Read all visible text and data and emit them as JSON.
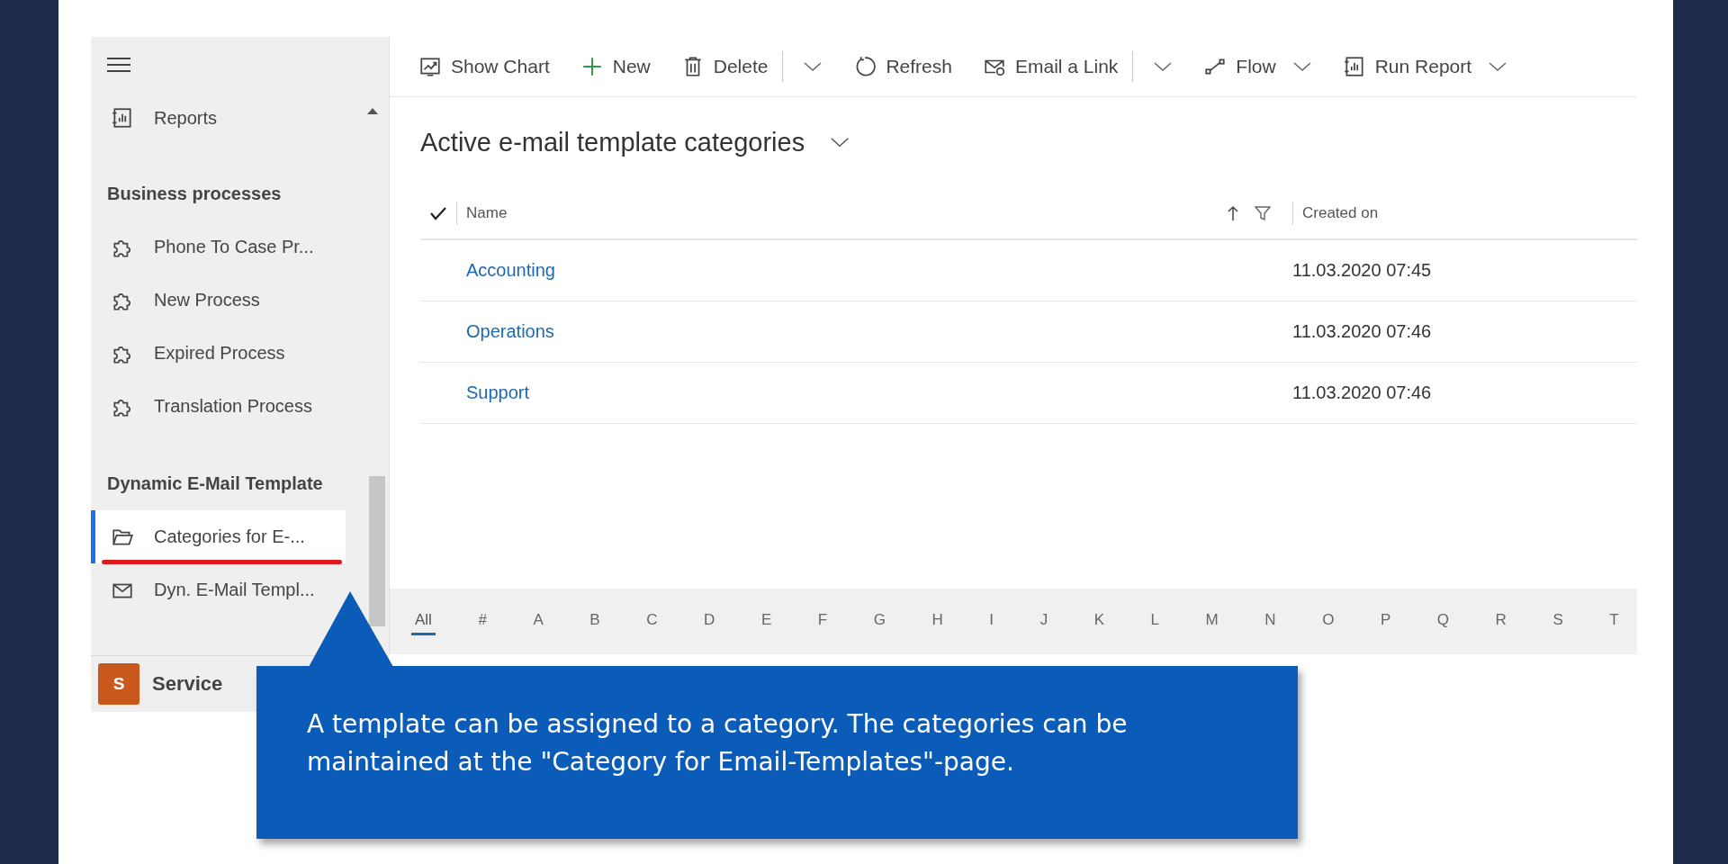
{
  "sidebar": {
    "sections": [
      {
        "items": [
          {
            "kind": "report",
            "label": "Reports",
            "selected": false
          }
        ]
      },
      {
        "header": "Business processes",
        "items": [
          {
            "kind": "puzzle",
            "label": "Phone To Case Pr...",
            "selected": false
          },
          {
            "kind": "puzzle",
            "label": "New Process",
            "selected": false
          },
          {
            "kind": "puzzle",
            "label": "Expired Process",
            "selected": false
          },
          {
            "kind": "puzzle",
            "label": "Translation Process",
            "selected": false
          }
        ]
      },
      {
        "header": "Dynamic E-Mail Template",
        "items": [
          {
            "kind": "folder",
            "label": "Categories for E-...",
            "selected": true
          },
          {
            "kind": "mail",
            "label": "Dyn. E-Mail Templ...",
            "selected": false
          }
        ]
      }
    ],
    "area": {
      "badge": "S",
      "label": "Service",
      "color": "#c8581b"
    }
  },
  "toolbar": [
    {
      "kind": "chart",
      "label": "Show Chart",
      "dropdown": false,
      "split": false
    },
    {
      "kind": "plus",
      "label": "New",
      "dropdown": false,
      "split": false
    },
    {
      "kind": "trash",
      "label": "Delete",
      "dropdown": true,
      "split": true
    },
    {
      "kind": "refresh",
      "label": "Refresh",
      "dropdown": false,
      "split": false
    },
    {
      "kind": "mail-link",
      "label": "Email a Link",
      "dropdown": true,
      "split": true
    },
    {
      "kind": "flow",
      "label": "Flow",
      "dropdown": true,
      "split": false
    },
    {
      "kind": "report",
      "label": "Run Report",
      "dropdown": true,
      "split": false
    }
  ],
  "view": {
    "title": "Active e-mail template categories",
    "columns": [
      {
        "label": "Name",
        "sort_ascending": true
      },
      {
        "label": "Created on",
        "sort_ascending": false
      }
    ],
    "rows": [
      {
        "name": "Accounting",
        "created": "11.03.2020 07:45"
      },
      {
        "name": "Operations",
        "created": "11.03.2020 07:46"
      },
      {
        "name": "Support",
        "created": "11.03.2020 07:46"
      }
    ]
  },
  "alphabet": [
    {
      "label": "All",
      "selected": true
    },
    {
      "label": "#",
      "selected": false
    },
    {
      "label": "A",
      "selected": false
    },
    {
      "label": "B",
      "selected": false
    },
    {
      "label": "C",
      "selected": false
    },
    {
      "label": "D",
      "selected": false
    },
    {
      "label": "E",
      "selected": false
    },
    {
      "label": "F",
      "selected": false
    },
    {
      "label": "G",
      "selected": false
    },
    {
      "label": "H",
      "selected": false
    },
    {
      "label": "I",
      "selected": false
    },
    {
      "label": "J",
      "selected": false
    },
    {
      "label": "K",
      "selected": false
    },
    {
      "label": "L",
      "selected": false
    },
    {
      "label": "M",
      "selected": false
    },
    {
      "label": "N",
      "selected": false
    },
    {
      "label": "O",
      "selected": false
    },
    {
      "label": "P",
      "selected": false
    },
    {
      "label": "Q",
      "selected": false
    },
    {
      "label": "R",
      "selected": false
    },
    {
      "label": "S",
      "selected": false
    },
    {
      "label": "T",
      "selected": false
    }
  ],
  "callout": {
    "text": "A template can be assigned to a category. The categories can be maintained at the \"Category for Email-Templates\"-page."
  }
}
